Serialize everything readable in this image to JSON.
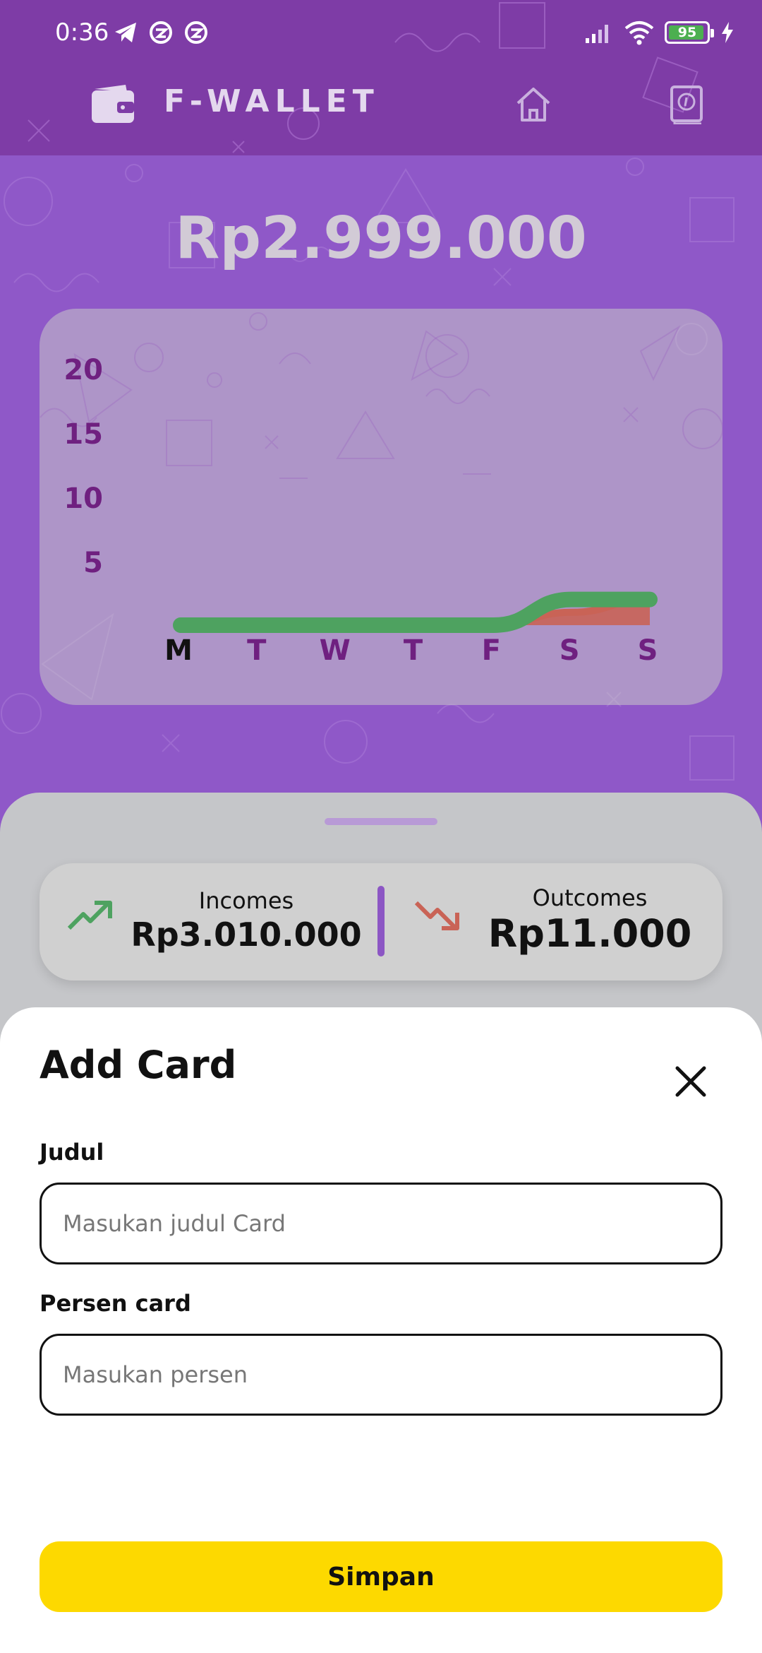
{
  "status_bar": {
    "time": "0:36",
    "battery": "95",
    "battery_level": 0.95,
    "icons_left": [
      "telegram-icon",
      "app-icon",
      "app-icon"
    ],
    "icons_right": [
      "signal-icon",
      "wifi-icon",
      "battery-icon",
      "charging-icon"
    ]
  },
  "header": {
    "brand": "F-WALLET",
    "icons": [
      "wallet-icon",
      "home-icon",
      "book-icon"
    ]
  },
  "balance": "Rp2.999.000",
  "chart_data": {
    "type": "area",
    "categories": [
      "M",
      "T",
      "W",
      "T",
      "F",
      "S",
      "S"
    ],
    "highlighted_category": "M",
    "y_ticks": [
      20,
      15,
      10,
      5
    ],
    "ylim": [
      0,
      20
    ],
    "series": [
      {
        "color": "#c96356",
        "values": [
          0,
          0,
          0,
          0,
          0,
          1,
          2
        ]
      },
      {
        "color": "#4ea260",
        "values": [
          0,
          0,
          0,
          0,
          0,
          2,
          2
        ]
      }
    ],
    "grid": false,
    "legend": "none"
  },
  "summary": {
    "incomes_label": "Incomes",
    "incomes_value": "Rp3.010.000",
    "outcomes_label": "Outcomes",
    "outcomes_value": "Rp11.000",
    "colors": {
      "income": "#4ea260",
      "outcome": "#c96356",
      "divider": "#8c56c4"
    }
  },
  "add_card": {
    "title": "Add Card",
    "judul_label": "Judul",
    "judul_placeholder": "Masukan judul Card",
    "judul_value": "",
    "persen_label": "Persen card",
    "persen_placeholder": "Masukan persen",
    "persen_value": "",
    "save_label": "Simpan",
    "save_color": "#fdd900"
  }
}
